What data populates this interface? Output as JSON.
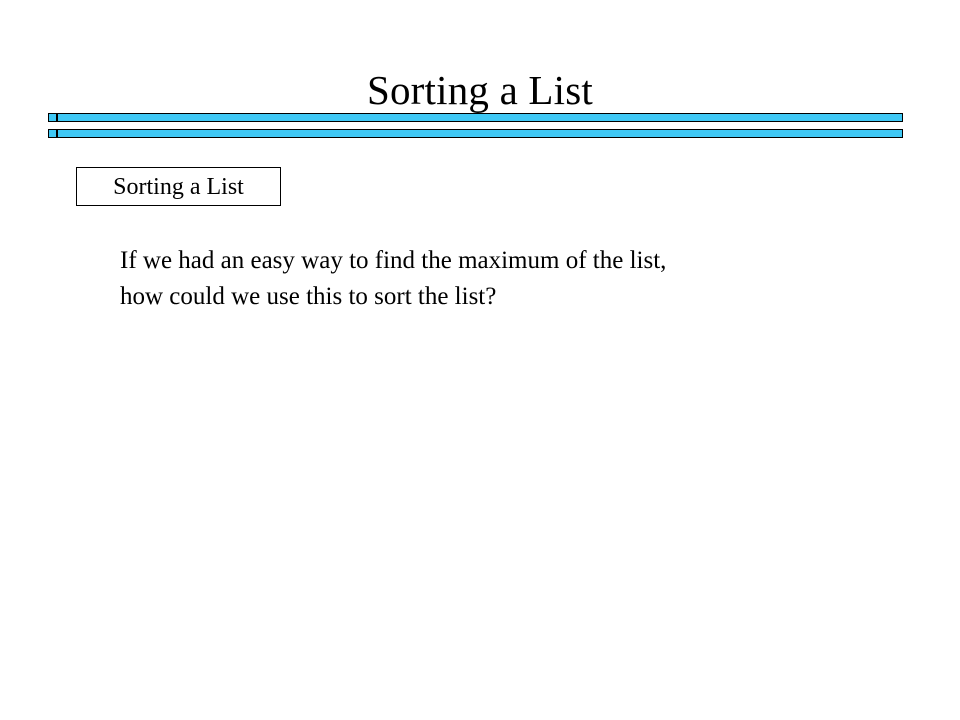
{
  "slide": {
    "title": "Sorting a List",
    "background_color": "#FFFFFF",
    "text_color": "#000000"
  },
  "divider": {
    "accent_color": "#3FC8F5",
    "border_color": "#000000",
    "bar_count": 2
  },
  "boxed_heading": {
    "label": "Sorting a List",
    "border_color": "#000000",
    "fill_color": "#FFFFFF"
  },
  "body": {
    "lines": [
      "If we had an easy way to find the maximum of the list,",
      "how could we use this to sort the list?"
    ]
  }
}
